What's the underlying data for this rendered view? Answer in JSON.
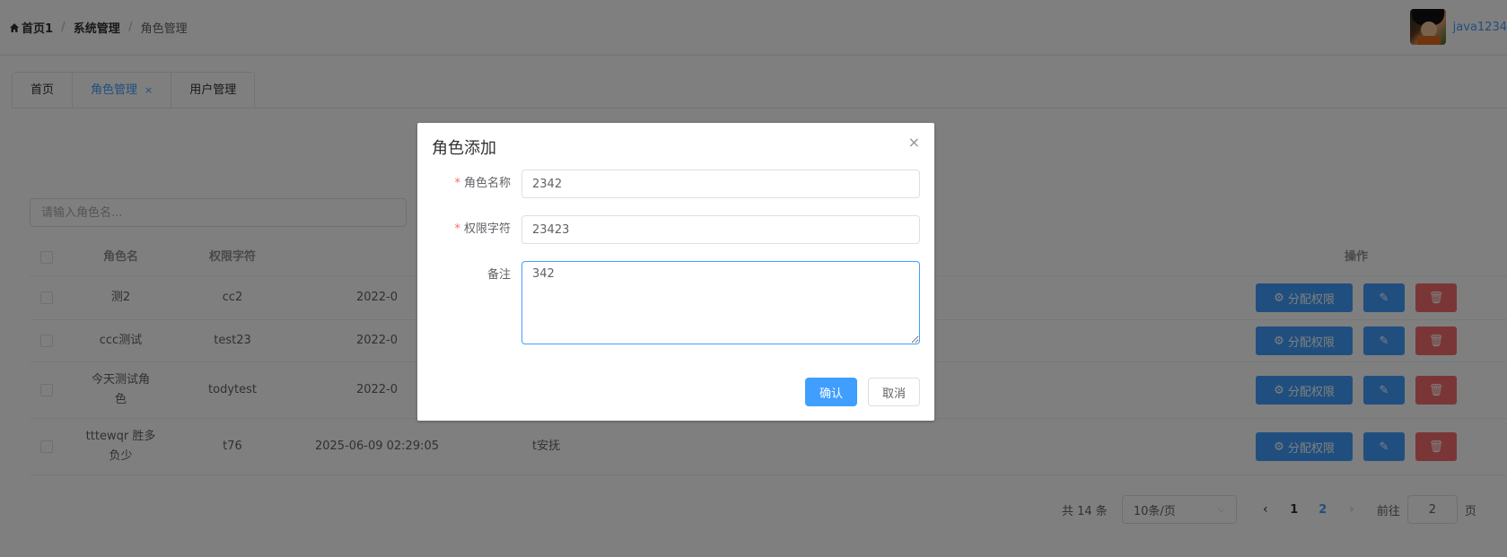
{
  "header": {
    "breadcrumb": [
      "首页1",
      "系统管理",
      "角色管理"
    ],
    "breadcrumb_sep": "/",
    "username": "java1234"
  },
  "tabs": [
    {
      "label": "首页",
      "active": false
    },
    {
      "label": "角色管理",
      "active": true,
      "closable": true
    },
    {
      "label": "用户管理",
      "active": false
    }
  ],
  "tab_close_glyph": "×",
  "search": {
    "placeholder": "请输入角色名..."
  },
  "table": {
    "columns": [
      "角色名",
      "权限字符",
      "",
      "",
      "操作"
    ],
    "rows": [
      {
        "name": "测2",
        "key": "cc2",
        "date": "2022-0",
        "remark": ""
      },
      {
        "name": "ccc测试",
        "key": "test23",
        "date": "2022-0",
        "remark": ""
      },
      {
        "name": "今天测试角色",
        "key": "todytest",
        "date": "2022-0",
        "remark": ""
      },
      {
        "name": "tttewqr 胜多负少",
        "key": "t76",
        "date": "2025-06-09 02:29:05",
        "remark": "t安抚"
      }
    ],
    "perm_button": "分配权限"
  },
  "pagination": {
    "total": "共 14 条",
    "page_size": "10条/页",
    "pages": [
      "1",
      "2"
    ],
    "current_page": "2",
    "goto_prefix": "前往",
    "goto_value": "2",
    "goto_suffix": "页"
  },
  "dialog": {
    "title": "角色添加",
    "close_glyph": "×",
    "fields": {
      "role_name": {
        "label": "角色名称",
        "value": "2342",
        "required": true
      },
      "perm_key": {
        "label": "权限字符",
        "value": "23423",
        "required": true
      },
      "remark": {
        "label": "备注",
        "value": "342",
        "required": false
      }
    },
    "confirm": "确认",
    "cancel": "取消"
  },
  "colors": {
    "primary": "#409eff",
    "danger": "#f56c6c",
    "overlay": "rgba(0,0,0,0.5)"
  },
  "icons": [
    "home-icon",
    "gear-icon",
    "edit-icon",
    "trash-icon",
    "close-icon",
    "chevron-down-icon",
    "chevron-left-icon",
    "chevron-right-icon"
  ]
}
